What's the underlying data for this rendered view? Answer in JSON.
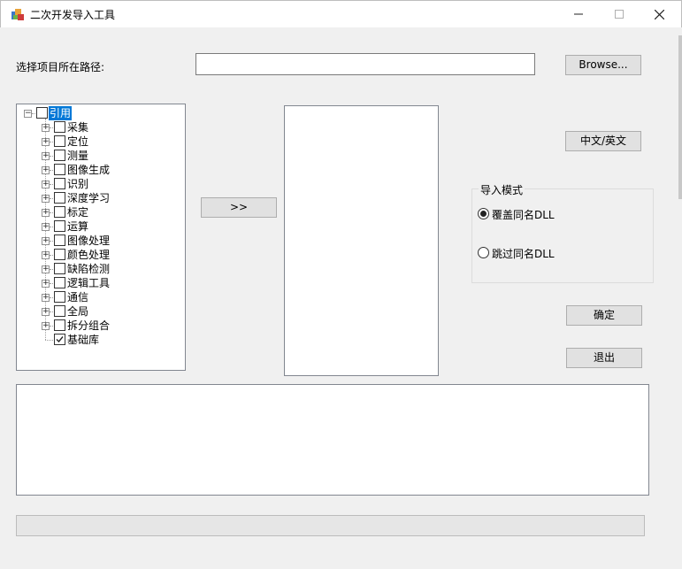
{
  "window": {
    "title": "二次开发导入工具",
    "min_glyph": "—",
    "max_glyph": "☐",
    "close_glyph": "✕"
  },
  "path": {
    "label": "选择项目所在路径:",
    "value": "",
    "browse_label": "Browse..."
  },
  "lang_button": "中文/英文",
  "move_button": ">>",
  "tree": {
    "root": "引用",
    "children": [
      {
        "label": "采集",
        "checked": false,
        "expandable": true
      },
      {
        "label": "定位",
        "checked": false,
        "expandable": true
      },
      {
        "label": "测量",
        "checked": false,
        "expandable": true
      },
      {
        "label": "图像生成",
        "checked": false,
        "expandable": true
      },
      {
        "label": "识别",
        "checked": false,
        "expandable": true
      },
      {
        "label": "深度学习",
        "checked": false,
        "expandable": true
      },
      {
        "label": "标定",
        "checked": false,
        "expandable": true
      },
      {
        "label": "运算",
        "checked": false,
        "expandable": true
      },
      {
        "label": "图像处理",
        "checked": false,
        "expandable": true
      },
      {
        "label": "颜色处理",
        "checked": false,
        "expandable": true
      },
      {
        "label": "缺陷检测",
        "checked": false,
        "expandable": true
      },
      {
        "label": "逻辑工具",
        "checked": false,
        "expandable": true
      },
      {
        "label": "通信",
        "checked": false,
        "expandable": true
      },
      {
        "label": "全局",
        "checked": false,
        "expandable": true
      },
      {
        "label": "拆分组合",
        "checked": false,
        "expandable": true
      },
      {
        "label": "基础库",
        "checked": true,
        "expandable": false
      }
    ]
  },
  "import_mode": {
    "title": "导入模式",
    "options": [
      {
        "label": "覆盖同名DLL",
        "selected": true
      },
      {
        "label": "跳过同名DLL",
        "selected": false
      }
    ]
  },
  "confirm_button": "确定",
  "exit_button": "退出",
  "colors": {
    "selection": "#0078d7",
    "window_bg": "#f0f0f0"
  }
}
